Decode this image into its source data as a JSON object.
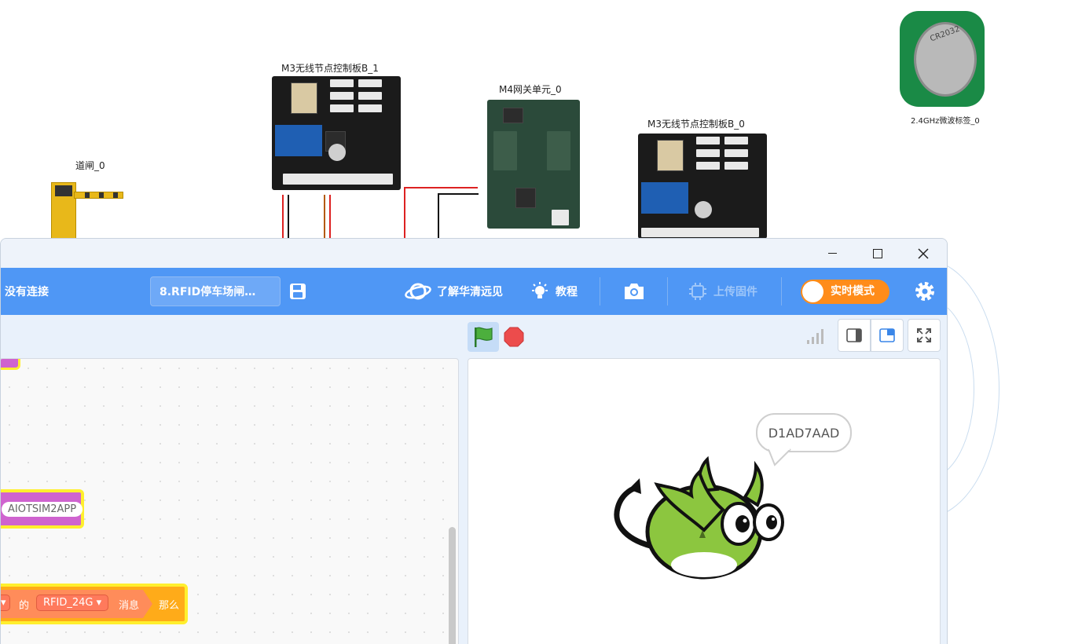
{
  "simulation": {
    "labels": {
      "gate": "道闸_0",
      "board_b1": "M3无线节点控制板B_1",
      "gateway": "M4网关单元_0",
      "board_b0": "M3无线节点控制板B_0",
      "tag": "2.4GHz微波标签_0"
    },
    "battery_text": "CR2032"
  },
  "window": {
    "controls": {
      "minimize": "—",
      "maximize": "☐",
      "close": "✕"
    }
  },
  "toolbar": {
    "connection_status": "没有连接",
    "project_name": "8.RFID停车场闸…",
    "learn_label": "了解华清远见",
    "tutorial_label": "教程",
    "upload_firmware_label": "上传固件",
    "realtime_mode_label": "实时模式",
    "icons": {
      "save": "save-icon",
      "planet": "planet-icon",
      "bulb": "lightbulb-icon",
      "camera": "camera-icon",
      "chip": "chip-icon",
      "settings": "gear-icon"
    },
    "colors": {
      "bar": "#4f97f5",
      "toggle": "#ff8c1a"
    }
  },
  "code_blocks": {
    "message_value": "AIOTSIM2APP",
    "of_label": "的",
    "rfid_dropdown": "RFID_24G",
    "message_label": "消息",
    "then_label": "那么"
  },
  "stage": {
    "speech_bubble": "D1AD7AAD"
  }
}
